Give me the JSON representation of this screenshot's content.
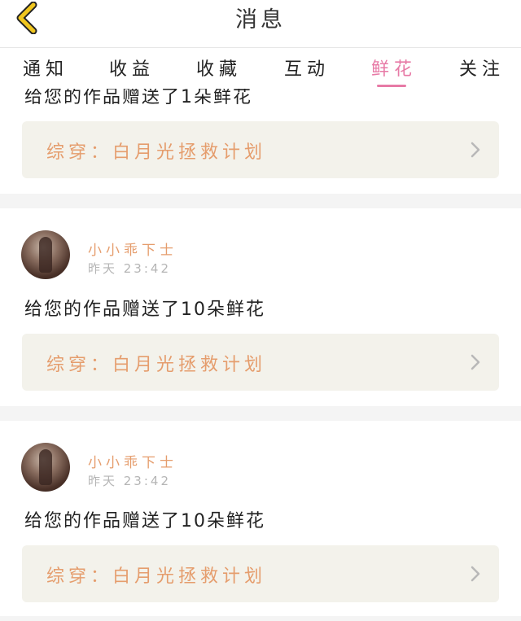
{
  "header": {
    "title": "消息",
    "back_icon": "chevron-left-icon",
    "accent_color": "#f0c61e"
  },
  "tabs": [
    {
      "label": "通知",
      "active": false
    },
    {
      "label": "收益",
      "active": false
    },
    {
      "label": "收藏",
      "active": false
    },
    {
      "label": "互动",
      "active": false
    },
    {
      "label": "鲜花",
      "active": true
    },
    {
      "label": "关注",
      "active": false
    }
  ],
  "active_tab_color": "#e77aa6",
  "feed": {
    "partial_item": {
      "message": "给您的作品赠送了1朵鲜花",
      "work_title": "综穿：白月光拯救计划"
    },
    "items": [
      {
        "username": "小小乖下士",
        "time": "昨天 23:42",
        "message": "给您的作品赠送了10朵鲜花",
        "work_title": "综穿：白月光拯救计划"
      },
      {
        "username": "小小乖下士",
        "time": "昨天 23:42",
        "message": "给您的作品赠送了10朵鲜花",
        "work_title": "综穿：白月光拯救计划"
      }
    ]
  }
}
